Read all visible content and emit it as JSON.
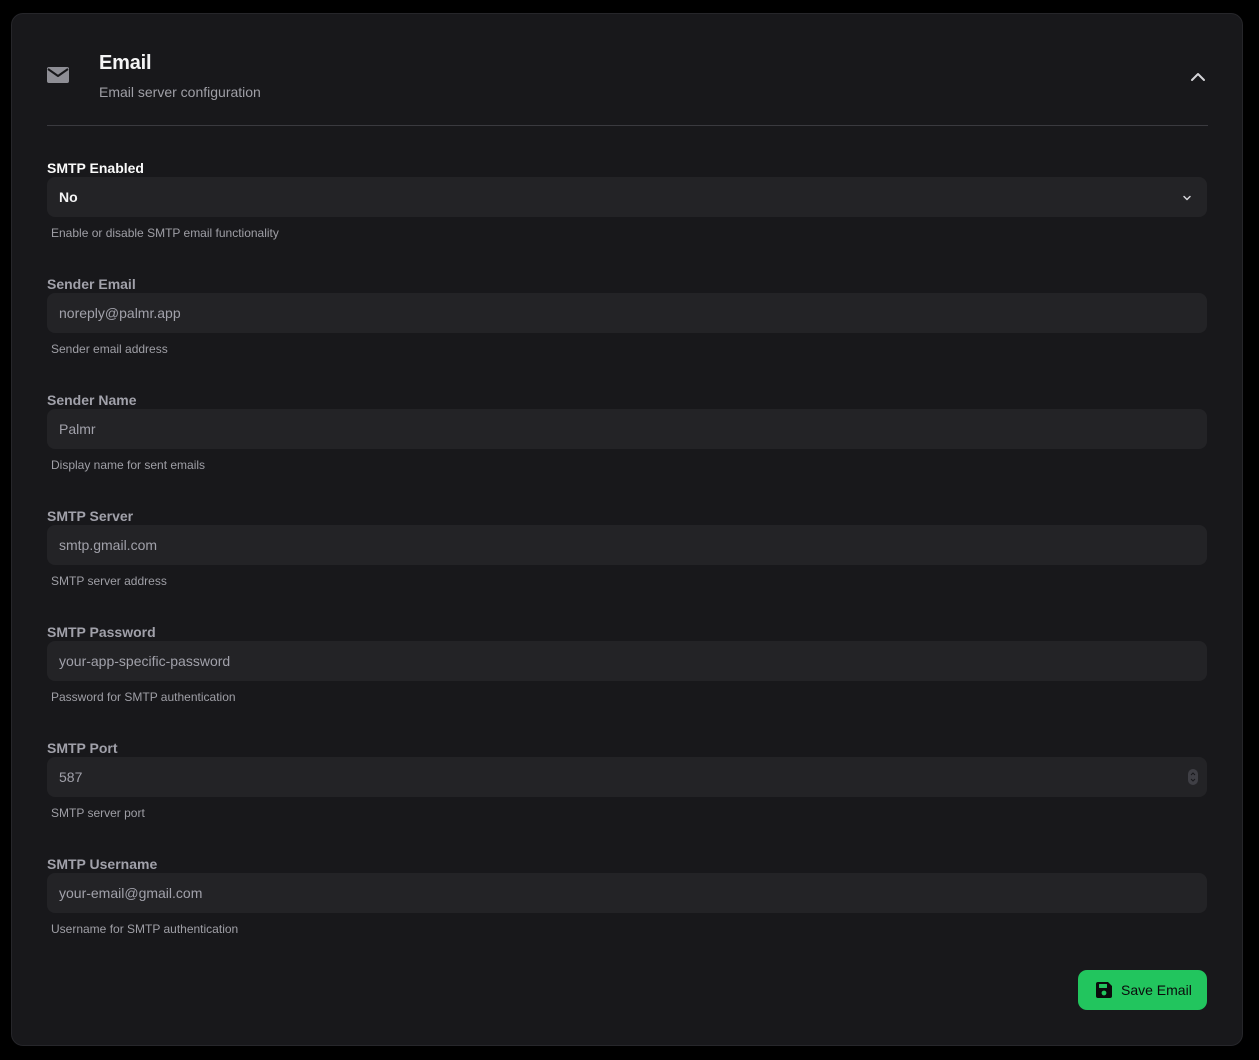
{
  "section": {
    "title": "Email",
    "subtitle": "Email server configuration",
    "icon": "mail-icon",
    "collapse_icon": "chevron-up-icon"
  },
  "fields": [
    {
      "label": "SMTP Enabled",
      "type": "select",
      "value": "No",
      "help": "Enable or disable SMTP email functionality"
    },
    {
      "label": "Sender Email",
      "type": "text",
      "value": "",
      "placeholder": "noreply@palmr.app",
      "help": "Sender email address"
    },
    {
      "label": "Sender Name",
      "type": "text",
      "value": "",
      "placeholder": "Palmr",
      "help": "Display name for sent emails"
    },
    {
      "label": "SMTP Server",
      "type": "text",
      "value": "",
      "placeholder": "smtp.gmail.com",
      "help": "SMTP server address"
    },
    {
      "label": "SMTP Password",
      "type": "text",
      "value": "",
      "placeholder": "your-app-specific-password",
      "help": "Password for SMTP authentication"
    },
    {
      "label": "SMTP Port",
      "type": "number",
      "value": "",
      "placeholder": "587",
      "help": "SMTP server port"
    },
    {
      "label": "SMTP Username",
      "type": "text",
      "value": "",
      "placeholder": "your-email@gmail.com",
      "help": "Username for SMTP authentication"
    }
  ],
  "actions": {
    "save_label": "Save Email",
    "save_icon": "save-icon"
  },
  "colors": {
    "accent": "#22c55e",
    "card_background": "#18181b",
    "input_background": "#232326"
  }
}
